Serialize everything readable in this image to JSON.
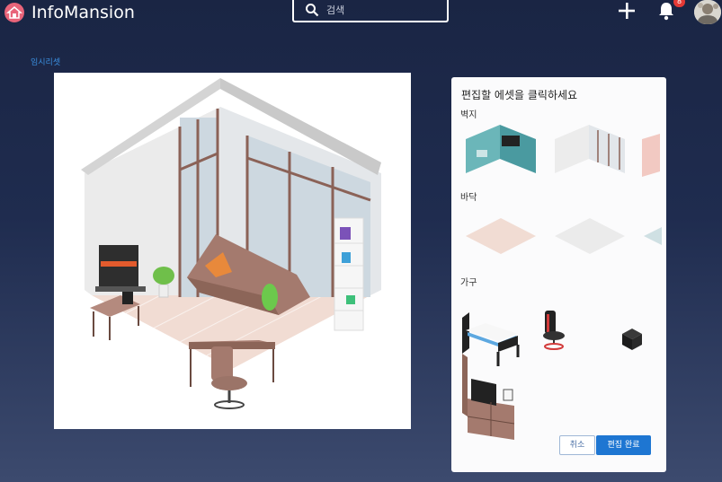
{
  "header": {
    "brand": "InfoMansion",
    "search_placeholder": "검색",
    "notification_count": "8"
  },
  "breadcrumb": "임시리셋",
  "panel": {
    "title": "편집할 에셋을 클릭하세요",
    "sections": {
      "wall": "벽지",
      "floor": "바닥",
      "furniture": "가구"
    },
    "cancel_label": "취소",
    "done_label": "편집 완료"
  },
  "icons": [
    "house-logo-icon",
    "search-icon",
    "plus-icon",
    "bell-icon"
  ],
  "colors": {
    "accent": "#1e76d2",
    "badge": "#e53935",
    "link": "#3b8fe0"
  }
}
